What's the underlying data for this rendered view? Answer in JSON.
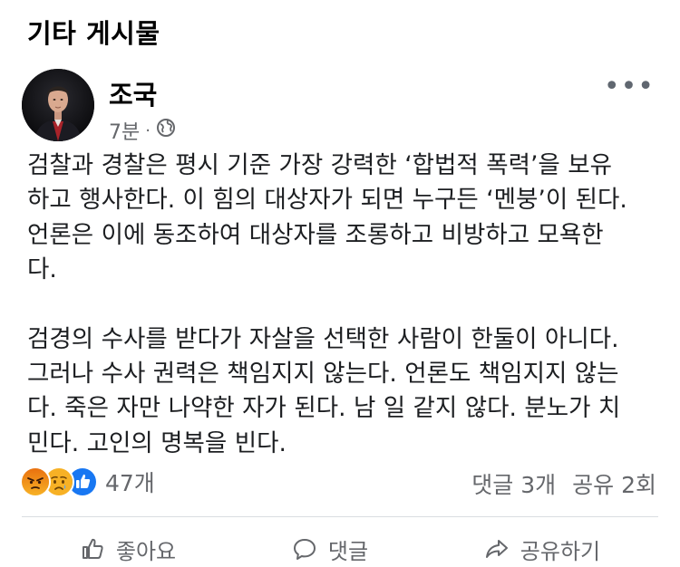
{
  "section": {
    "title": "기타 게시물"
  },
  "post": {
    "author": "조국",
    "time": "7분",
    "separator": "·",
    "paragraphs": [
      "검찰과 경찰은 평시 기준 가장 강력한 ‘합법적 폭력’을 보유\n하고 행사한다. 이 힘의 대상자가 되면 누구든 ‘멘붕’이 된다.\n언론은 이에 동조하여 대상자를 조롱하고 비방하고 모욕한\n다.",
      "검경의 수사를 받다가 자살을 선택한 사람이 한둘이 아니다.\n그러나 수사 권력은 책임지지 않는다. 언론도 책임지지 않는\n다. 죽은 자만 나약한 자가 된다. 남 일 같지 않다. 분노가 치\n민다. 고인의 명복을 빈다."
    ]
  },
  "reactions": {
    "icons": [
      "angry-reaction-icon",
      "sad-reaction-icon",
      "like-reaction-icon"
    ],
    "count": "47개",
    "comments": "댓글 3개",
    "shares": "공유 2회"
  },
  "actions": {
    "like": "좋아요",
    "comment": "댓글",
    "share": "공유하기"
  },
  "colors": {
    "text": "#1c1e21",
    "muted": "#65676b",
    "like_blue": "#1877f2",
    "angry_top": "#e9710f",
    "sad_yellow": "#f7b125"
  }
}
